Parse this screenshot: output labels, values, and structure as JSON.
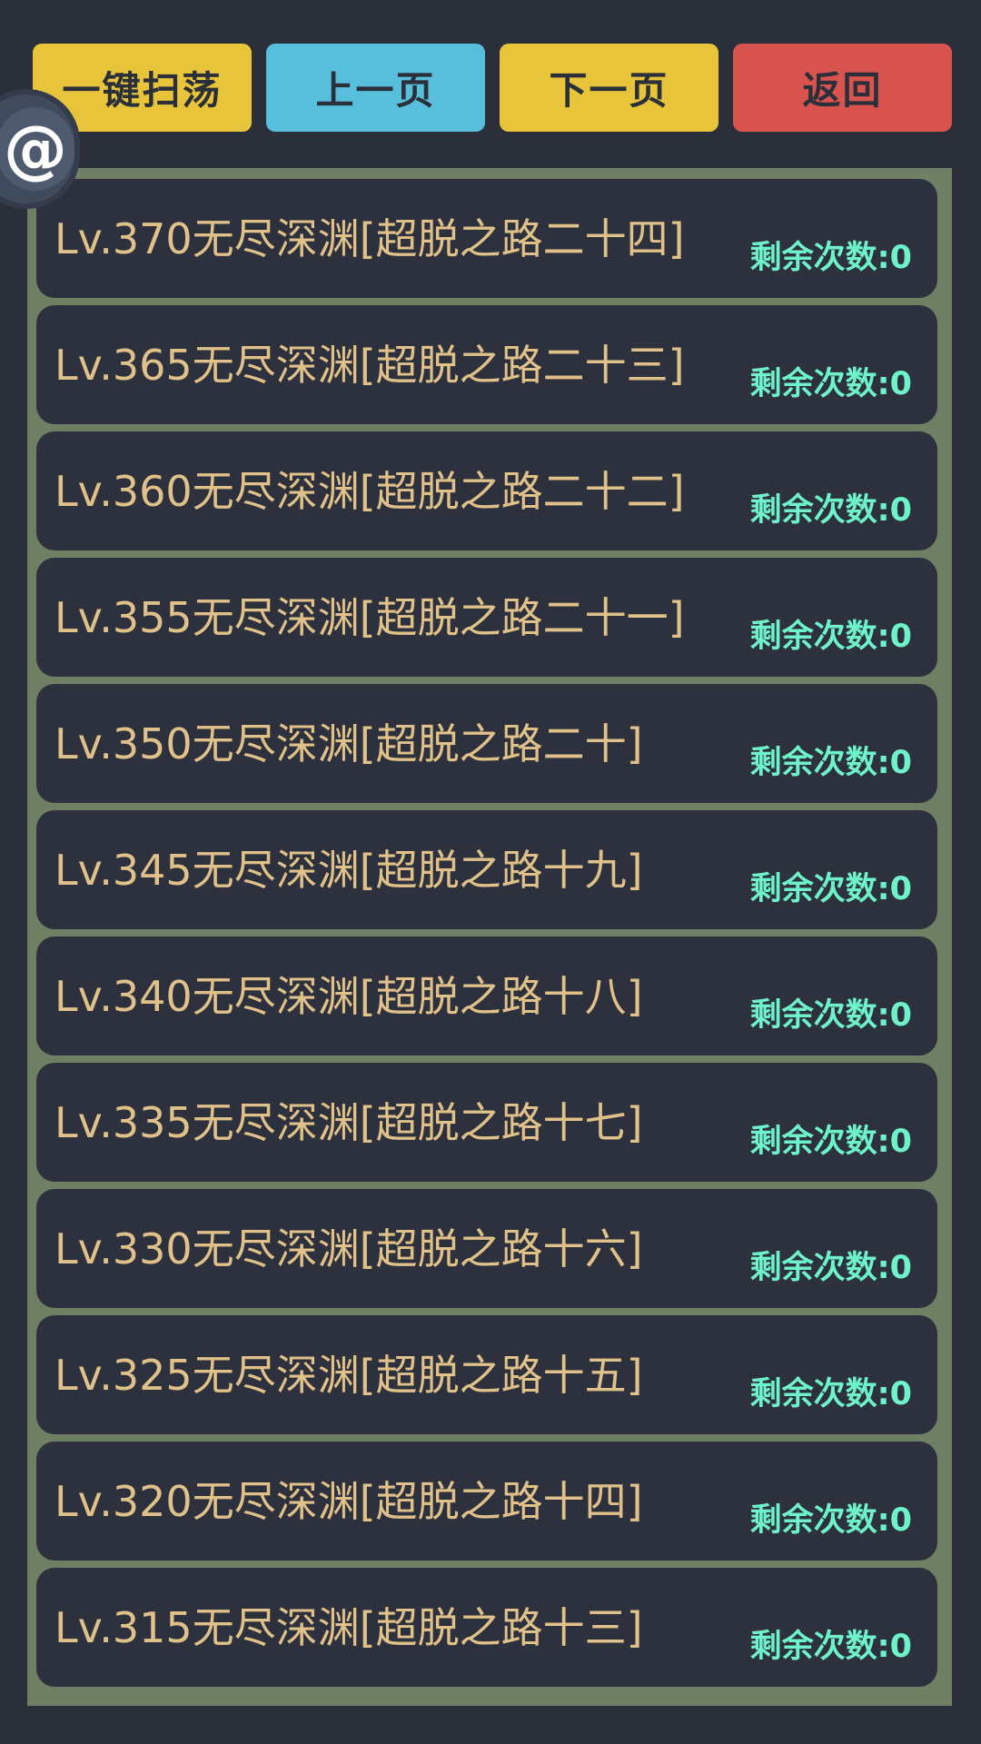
{
  "toolbar": {
    "sweep_label": "一键扫荡",
    "prev_label": "上一页",
    "next_label": "下一页",
    "back_label": "返回"
  },
  "floating_button": {
    "glyph": "@"
  },
  "colors": {
    "sweep": "#e8c43a",
    "prev": "#57bedb",
    "next": "#e8c43a",
    "back": "#d9534f",
    "row_text": "#e0c189",
    "count_text": "#6ef2c9",
    "frame": "#6f7f64"
  },
  "dungeons": [
    {
      "title": "Lv.370无尽深渊[超脱之路二十四]",
      "remaining": "剩余次数:0"
    },
    {
      "title": "Lv.365无尽深渊[超脱之路二十三]",
      "remaining": "剩余次数:0"
    },
    {
      "title": "Lv.360无尽深渊[超脱之路二十二]",
      "remaining": "剩余次数:0"
    },
    {
      "title": "Lv.355无尽深渊[超脱之路二十一]",
      "remaining": "剩余次数:0"
    },
    {
      "title": "Lv.350无尽深渊[超脱之路二十]",
      "remaining": "剩余次数:0"
    },
    {
      "title": "Lv.345无尽深渊[超脱之路十九]",
      "remaining": "剩余次数:0"
    },
    {
      "title": "Lv.340无尽深渊[超脱之路十八]",
      "remaining": "剩余次数:0"
    },
    {
      "title": "Lv.335无尽深渊[超脱之路十七]",
      "remaining": "剩余次数:0"
    },
    {
      "title": "Lv.330无尽深渊[超脱之路十六]",
      "remaining": "剩余次数:0"
    },
    {
      "title": "Lv.325无尽深渊[超脱之路十五]",
      "remaining": "剩余次数:0"
    },
    {
      "title": "Lv.320无尽深渊[超脱之路十四]",
      "remaining": "剩余次数:0"
    },
    {
      "title": "Lv.315无尽深渊[超脱之路十三]",
      "remaining": "剩余次数:0"
    }
  ]
}
